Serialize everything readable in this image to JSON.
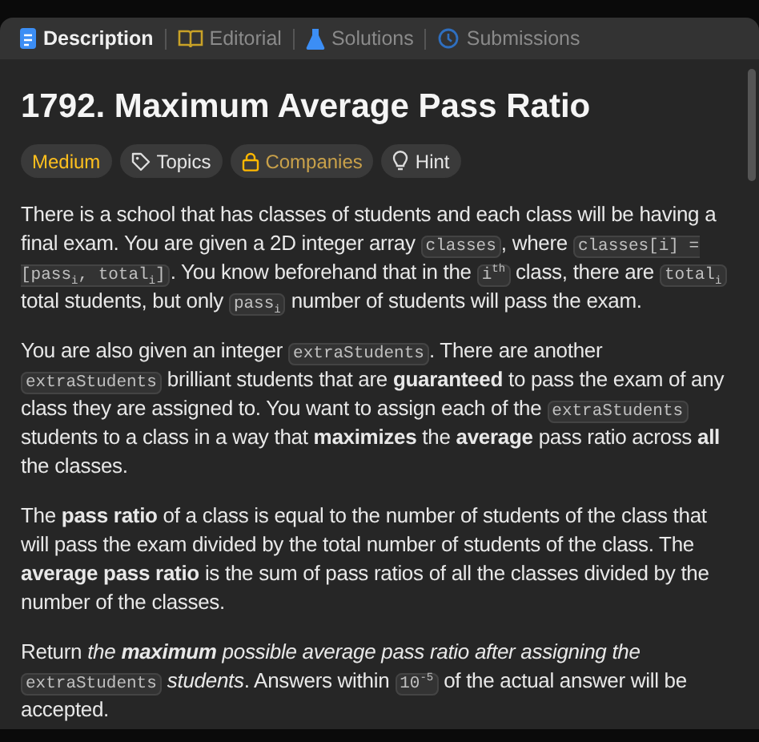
{
  "tabs": [
    {
      "label": "Description",
      "selected": true
    },
    {
      "label": "Editorial",
      "selected": false
    },
    {
      "label": "Solutions",
      "selected": false
    },
    {
      "label": "Submissions",
      "selected": false
    }
  ],
  "title": "1792. Maximum Average Pass Ratio",
  "tags": [
    {
      "label": "Medium",
      "kind": "difficulty"
    },
    {
      "label": "Topics",
      "kind": "topics"
    },
    {
      "label": "Companies",
      "kind": "companies"
    },
    {
      "label": "Hint",
      "kind": "hint"
    }
  ],
  "paragraphs": [
    {
      "segments": [
        {
          "kind": "text",
          "text": "There is a school that has classes of students and each class will be having a final exam. You are given a 2D integer array "
        },
        {
          "kind": "code",
          "text": "classes"
        },
        {
          "kind": "text",
          "text": ", where "
        },
        {
          "kind": "code",
          "text": "classes[i] = [pass$_{i}$, total$_{i}$]"
        },
        {
          "kind": "text",
          "text": ". You know beforehand that in the "
        },
        {
          "kind": "code",
          "text": "i$^{th}$"
        },
        {
          "kind": "text",
          "text": " class, there are "
        },
        {
          "kind": "code",
          "text": "total$_{i}$"
        },
        {
          "kind": "text",
          "text": " total students, but only "
        },
        {
          "kind": "code",
          "text": "pass$_{i}$"
        },
        {
          "kind": "text",
          "text": " number of students will pass the exam."
        }
      ]
    },
    {
      "segments": [
        {
          "kind": "text",
          "text": "You are also given an integer "
        },
        {
          "kind": "code",
          "text": "extraStudents"
        },
        {
          "kind": "text",
          "text": ". There are another "
        },
        {
          "kind": "code",
          "text": "extraStudents"
        },
        {
          "kind": "text",
          "text": " brilliant students that are **guaranteed** to pass the exam of any class they are assigned to. You want to assign each of the "
        },
        {
          "kind": "code",
          "text": "extraStudents"
        },
        {
          "kind": "text",
          "text": " students to a class in a way that **maximizes** the **average** pass ratio across **all** the classes."
        }
      ]
    },
    {
      "segments": [
        {
          "kind": "text",
          "text": "The **pass ratio** of a class is equal to the number of students of the class that will pass the exam divided by the total number of students of the class. The **average pass ratio** is the sum of pass ratios of all the classes divided by the number of the classes."
        }
      ]
    },
    {
      "segments": [
        {
          "kind": "text",
          "text": "Return "
        },
        {
          "kind": "emphasis",
          "text": "the **maximum** possible average pass ratio after assigning the "
        },
        {
          "kind": "code",
          "text": "extraStudents"
        },
        {
          "kind": "text",
          "text": " *students*. Answers within "
        },
        {
          "kind": "code",
          "text": "10$^{-5}$"
        },
        {
          "kind": "text",
          "text": " of the actual answer will be accepted."
        }
      ]
    }
  ]
}
